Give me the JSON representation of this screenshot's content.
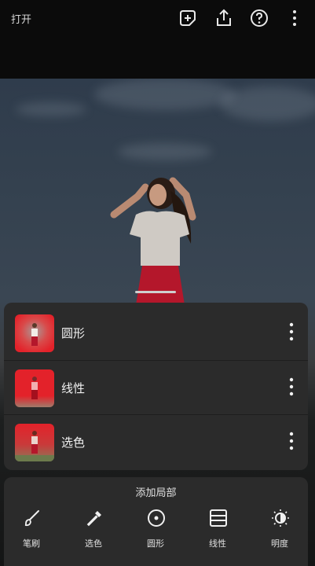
{
  "header": {
    "open_label": "打开",
    "icons": [
      "add-mask-icon",
      "share-icon",
      "help-icon",
      "more-vert-icon"
    ]
  },
  "masks": [
    {
      "label": "圆形",
      "thumb_icon": "mask-thumbnail"
    },
    {
      "label": "线性",
      "thumb_icon": "mask-thumbnail"
    },
    {
      "label": "选色",
      "thumb_icon": "mask-thumbnail"
    }
  ],
  "add_local": {
    "title": "添加局部",
    "tools": [
      {
        "label": "笔刷",
        "icon": "brush-icon"
      },
      {
        "label": "选色",
        "icon": "eyedropper-icon"
      },
      {
        "label": "圆形",
        "icon": "radial-icon"
      },
      {
        "label": "线性",
        "icon": "linear-icon"
      },
      {
        "label": "明度",
        "icon": "luminance-icon"
      }
    ]
  },
  "colors": {
    "panel": "#2b2b2b",
    "background": "#0b0b0b",
    "mask_red": "#e3222a"
  }
}
